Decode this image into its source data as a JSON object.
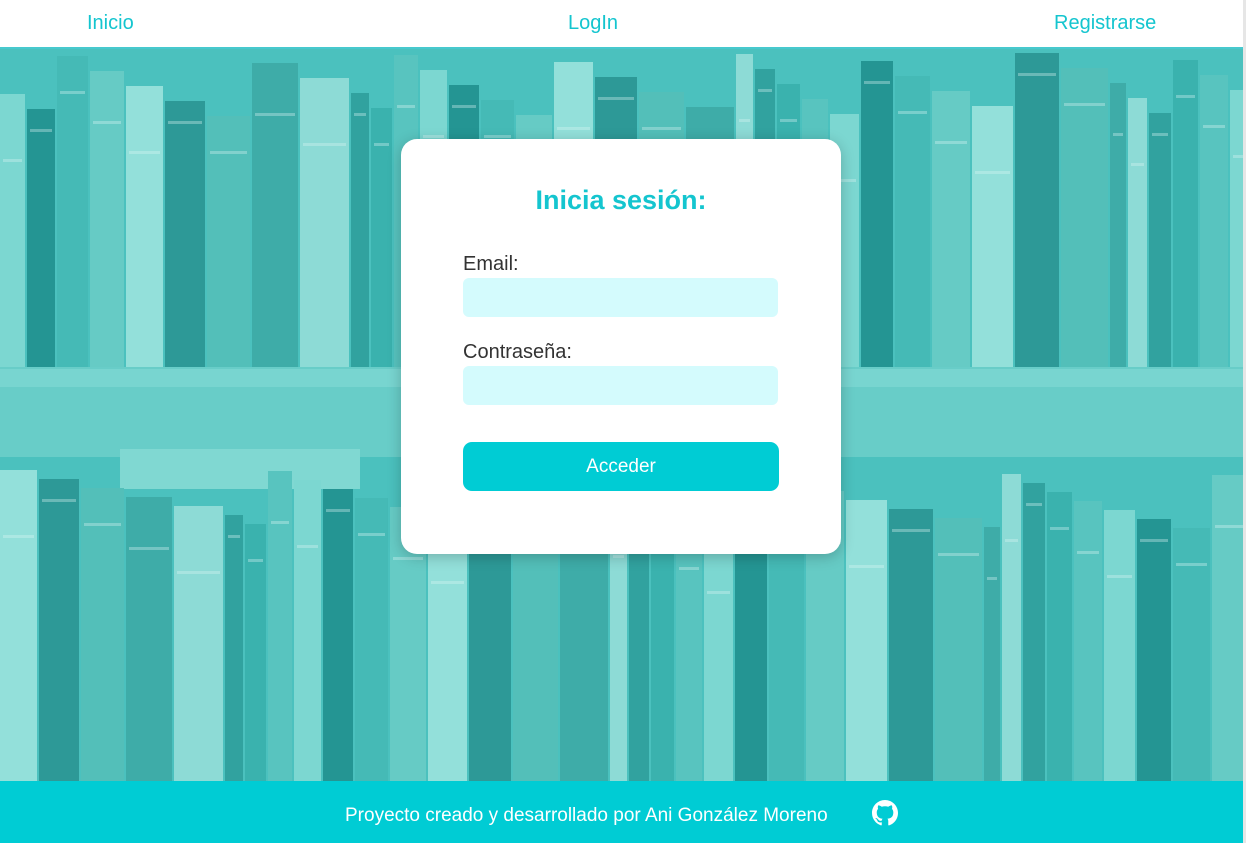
{
  "nav": {
    "items": [
      {
        "label": "Inicio"
      },
      {
        "label": "LogIn"
      },
      {
        "label": "Registrarse"
      }
    ]
  },
  "login": {
    "title": "Inicia sesión:",
    "email_label": "Email:",
    "email_value": "",
    "password_label": "Contraseña:",
    "password_value": "",
    "submit_label": "Acceder"
  },
  "footer": {
    "text": "Proyecto creado y desarrollado por Ani González Moreno",
    "icon": "github-icon"
  },
  "colors": {
    "accent": "#00ccd4",
    "nav_text": "#14c5cf",
    "input_bg": "#d4fbfd",
    "background_tint": "#4fc0bc"
  }
}
